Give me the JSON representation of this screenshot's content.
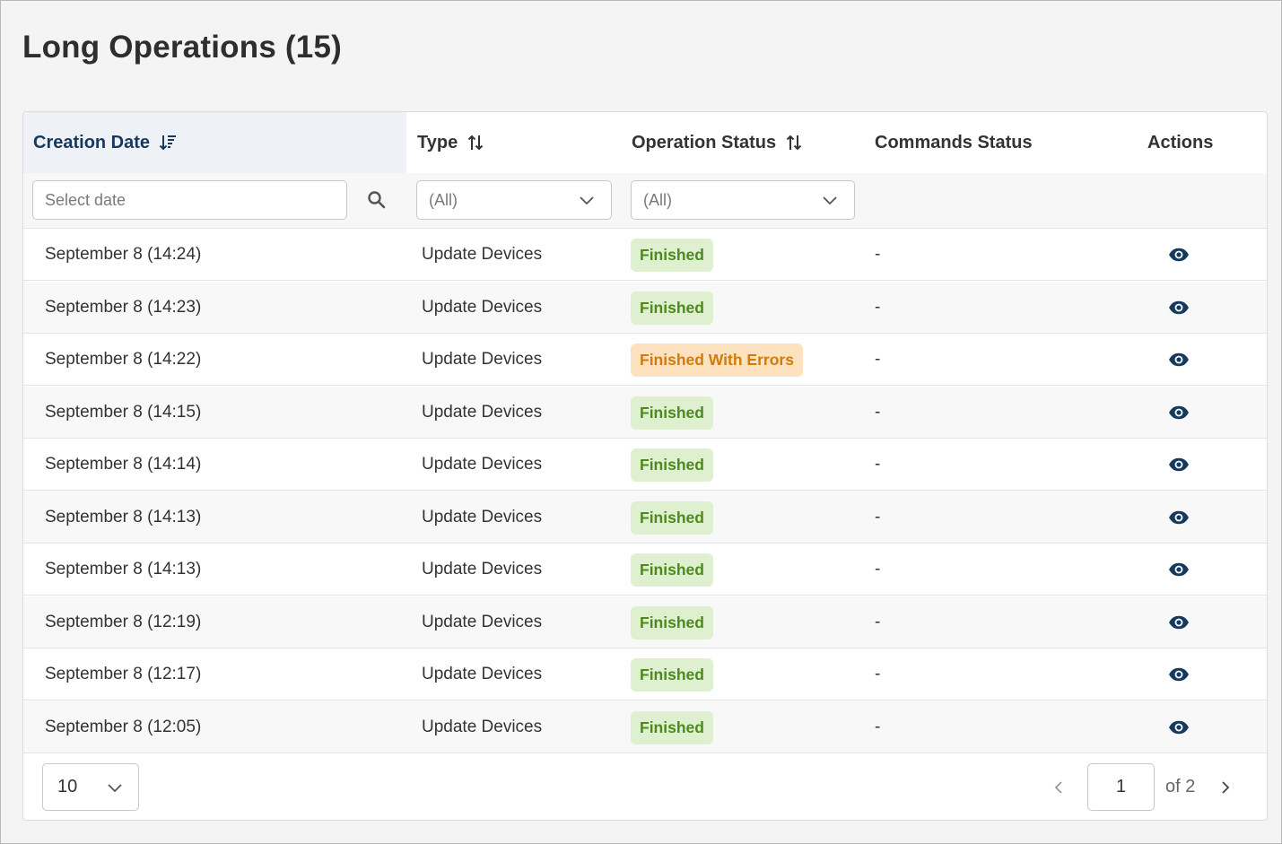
{
  "page": {
    "title": "Long Operations (15)"
  },
  "table": {
    "columns": {
      "creation_date": "Creation Date",
      "type": "Type",
      "operation_status": "Operation Status",
      "commands_status": "Commands Status",
      "actions": "Actions"
    },
    "filters": {
      "date_placeholder": "Select date",
      "type_value": "(All)",
      "status_value": "(All)"
    },
    "rows": [
      {
        "date": "September 8 (14:24)",
        "type": "Update Devices",
        "status": "Finished",
        "status_kind": "ok",
        "commands": "-"
      },
      {
        "date": "September 8 (14:23)",
        "type": "Update Devices",
        "status": "Finished",
        "status_kind": "ok",
        "commands": "-"
      },
      {
        "date": "September 8 (14:22)",
        "type": "Update Devices",
        "status": "Finished With Errors",
        "status_kind": "warn",
        "commands": "-"
      },
      {
        "date": "September 8 (14:15)",
        "type": "Update Devices",
        "status": "Finished",
        "status_kind": "ok",
        "commands": "-"
      },
      {
        "date": "September 8 (14:14)",
        "type": "Update Devices",
        "status": "Finished",
        "status_kind": "ok",
        "commands": "-"
      },
      {
        "date": "September 8 (14:13)",
        "type": "Update Devices",
        "status": "Finished",
        "status_kind": "ok",
        "commands": "-"
      },
      {
        "date": "September 8 (14:13)",
        "type": "Update Devices",
        "status": "Finished",
        "status_kind": "ok",
        "commands": "-"
      },
      {
        "date": "September 8 (12:19)",
        "type": "Update Devices",
        "status": "Finished",
        "status_kind": "ok",
        "commands": "-"
      },
      {
        "date": "September 8 (12:17)",
        "type": "Update Devices",
        "status": "Finished",
        "status_kind": "ok",
        "commands": "-"
      },
      {
        "date": "September 8 (12:05)",
        "type": "Update Devices",
        "status": "Finished",
        "status_kind": "ok",
        "commands": "-"
      }
    ]
  },
  "pagination": {
    "page_size": "10",
    "current_page": "1",
    "of_label": "of 2"
  },
  "colors": {
    "accent": "#163a5f",
    "status_ok_bg": "#dff0d0",
    "status_ok_text": "#4c8a1f",
    "status_warn_bg": "#fde2c0",
    "status_warn_text": "#d07b0b"
  },
  "icons": {
    "sort_desc": "sort-descending-icon",
    "sort_both": "sort-icon",
    "search": "search-icon",
    "dropdown": "chevron-down-icon",
    "view": "eye-icon",
    "prev": "chevron-left-icon",
    "next": "chevron-right-icon"
  }
}
